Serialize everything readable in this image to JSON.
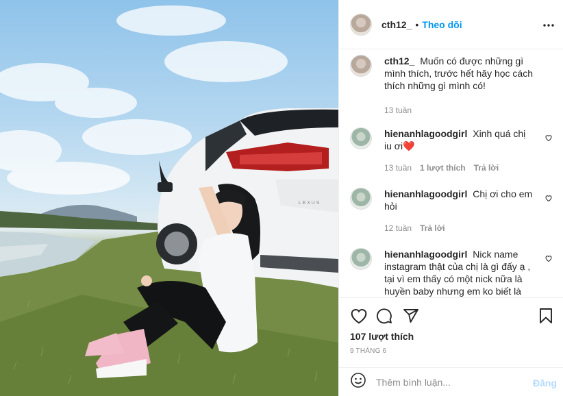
{
  "post": {
    "author": "cth12_",
    "separator": "•",
    "follow_label": "Theo dõi",
    "more_icon": "more-horizontal-icon",
    "caption": "Muốn có được những gì mình thích, trước hết hãy học cách thích những gì mình có!",
    "caption_time": "13 tuần"
  },
  "comments": [
    {
      "user": "hienanhlagoodgirl",
      "text": "Xinh quá chị iu ơi",
      "emoji": "❤️",
      "time": "13 tuần",
      "likes": "1 lượt thích",
      "reply": "Trả lời"
    },
    {
      "user": "hienanhlagoodgirl",
      "text": "Chị ơi cho em hỏi",
      "time": "12 tuần",
      "reply": "Trả lời"
    },
    {
      "user": "hienanhlagoodgirl",
      "text": "Nick name instagram thật của chị là gì đấy ạ , tại vì em thấy có một nick nữa là huyền baby nhưng em ko biết là"
    }
  ],
  "actions": {
    "like_icon": "heart-icon",
    "comment_icon": "comment-icon",
    "share_icon": "send-icon",
    "save_icon": "bookmark-icon",
    "likes_count": "107 lượt thích",
    "date": "9 THÁNG 6"
  },
  "add_comment": {
    "emoji_icon": "smiley-icon",
    "placeholder": "Thêm bình luận...",
    "post_label": "Đăng"
  },
  "colors": {
    "accent": "#0095f6",
    "post_disabled": "#b3dbff",
    "heart_red": "#ed4956"
  }
}
